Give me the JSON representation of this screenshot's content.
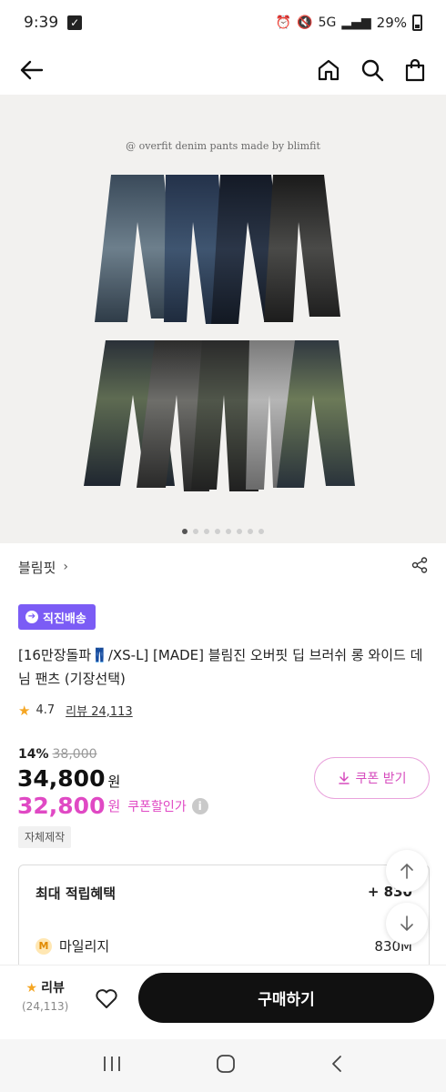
{
  "status": {
    "time": "9:39",
    "battery": "29%",
    "network": "5G"
  },
  "nav": {
    "back_icon": "arrow-left-icon",
    "home_icon": "home-icon",
    "search_icon": "search-icon",
    "cart_icon": "shopping-bag-icon"
  },
  "hero": {
    "caption": "@ overfit denim pants made by blimfit",
    "slide_count": 8,
    "active_slide": 1
  },
  "brand": {
    "name": "블림핏",
    "share_icon": "share-icon"
  },
  "badge": {
    "label": "직진배송"
  },
  "product": {
    "title": "[16만장돌파👖/XS-L] [MADE] 블림진 오버핏 딥 브러쉬 롱 와이드 데님 팬츠 (기장선택)",
    "rating": "4.7",
    "review_label": "리뷰 24,113",
    "discount_pct": "14%",
    "original_price": "38,000",
    "price": "34,800",
    "price_unit": "원",
    "coupon_price": "32,800",
    "coupon_price_unit": "원",
    "coupon_label": "쿠폰할인가",
    "coupon_button": "쿠폰 받기",
    "tag": "자체제작"
  },
  "benefit": {
    "title": "최대 적립혜택",
    "total": "+ 830",
    "mileage_label": "마일리지",
    "mileage_value": "830M",
    "mileage_icon_text": "M"
  },
  "bottom": {
    "review_label": "리뷰",
    "review_count": "(24,113)",
    "buy_label": "구매하기"
  },
  "colors": {
    "accent_purple": "#7b5cf5",
    "coupon_pink": "#e049c4",
    "star": "#f5a623"
  }
}
